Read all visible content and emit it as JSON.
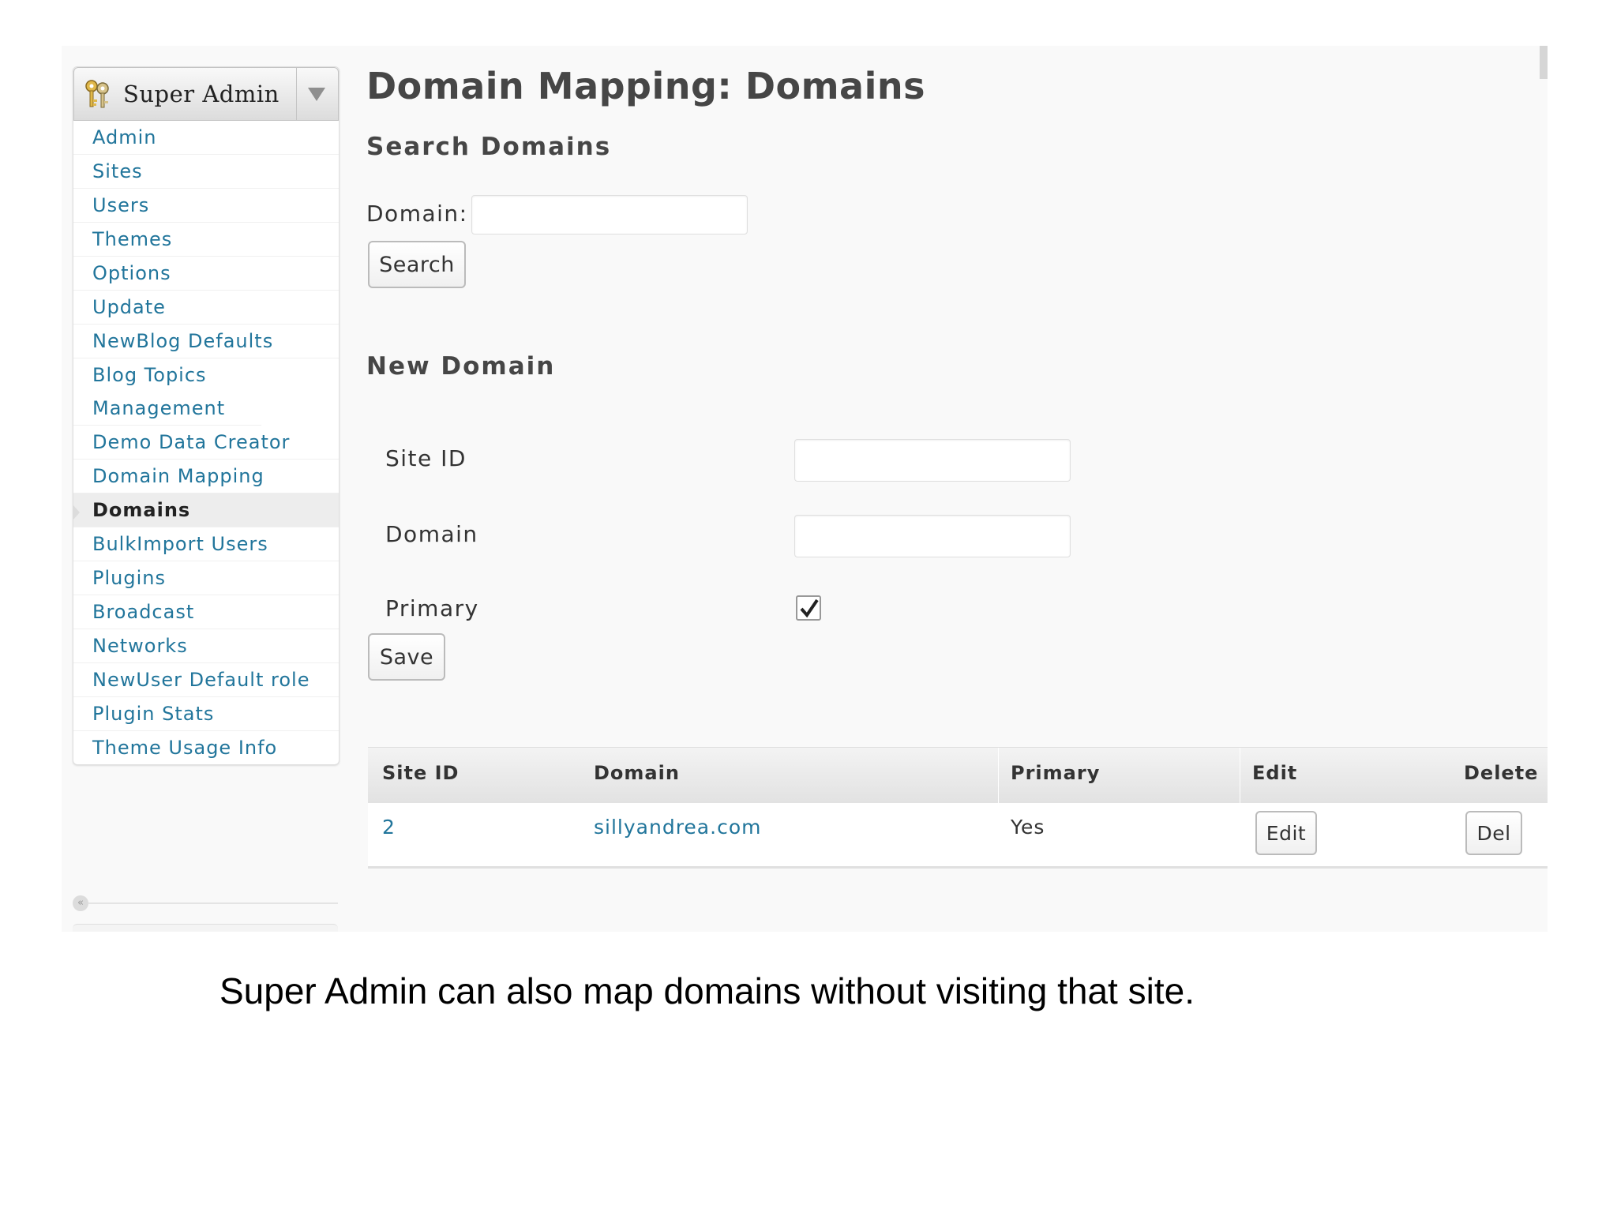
{
  "sidebar": {
    "header_title": "Super Admin",
    "items": [
      {
        "label": "Admin"
      },
      {
        "label": "Sites"
      },
      {
        "label": "Users"
      },
      {
        "label": "Themes"
      },
      {
        "label": "Options"
      },
      {
        "label": "Update"
      },
      {
        "label": "NewBlog Defaults"
      },
      {
        "label": "Blog Topics Management"
      },
      {
        "label": "Demo Data Creator"
      },
      {
        "label": "Domain Mapping"
      },
      {
        "label": "Domains",
        "current": true
      },
      {
        "label": "BulkImport Users"
      },
      {
        "label": "Plugins"
      },
      {
        "label": "Broadcast"
      },
      {
        "label": "Networks"
      },
      {
        "label": "NewUser Default role"
      },
      {
        "label": "Plugin Stats"
      },
      {
        "label": "Theme Usage Info"
      }
    ],
    "collapse_icon": "«"
  },
  "page": {
    "title": "Domain Mapping: Domains"
  },
  "search": {
    "section_title": "Search Domains",
    "domain_label": "Domain:",
    "domain_value": "",
    "button_label": "Search"
  },
  "new_domain": {
    "section_title": "New Domain",
    "site_id_label": "Site ID",
    "site_id_value": "",
    "domain_label": "Domain",
    "domain_value": "",
    "primary_label": "Primary",
    "primary_checked": true,
    "save_label": "Save"
  },
  "table": {
    "headers": {
      "site_id": "Site ID",
      "domain": "Domain",
      "primary": "Primary",
      "edit": "Edit",
      "delete": "Delete"
    },
    "rows": [
      {
        "site_id": "2",
        "domain": "sillyandrea.com",
        "primary": "Yes",
        "edit_label": "Edit",
        "delete_label": "Del"
      }
    ]
  },
  "caption": "Super Admin can also map domains without visiting that site.",
  "colors": {
    "link": "#21759b",
    "title": "#464646",
    "panel_bg": "#f9f9f9"
  }
}
